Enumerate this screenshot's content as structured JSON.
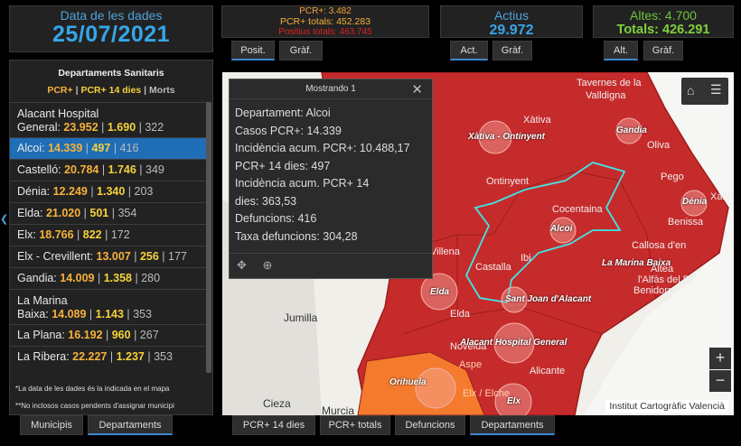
{
  "date": {
    "label": "Data de les dades",
    "value": "25/07/2021"
  },
  "pcr": {
    "pcr": "PCR+: 3.482",
    "totals": "PCR+ totals: 452.283",
    "positius": "Positius totals: 463.745"
  },
  "actius": {
    "label": "Actius",
    "value": "29.972"
  },
  "altes": {
    "label": "Altes: 4.700",
    "totals": "Totals: 426.291"
  },
  "tabs": {
    "posit": "Posit.",
    "graf1": "Gràf.",
    "act": "Act.",
    "graf2": "Gràf.",
    "alt": "Alt.",
    "graf3": "Gràf."
  },
  "list": {
    "title": "Departaments Sanitaris",
    "legend": {
      "a": "PCR+",
      "sep1": " | ",
      "b": "PCR+ 14 dies",
      "sep2": " | ",
      "c": "Morts"
    },
    "rows": [
      {
        "name": "Alacant Hospital",
        "name2": "General: ",
        "a": "23.952",
        "b": "1.690",
        "c": "322"
      },
      {
        "name": "Alcoi: ",
        "a": "14.339",
        "b": "497",
        "c": "416"
      },
      {
        "name": "Castelló: ",
        "a": "20.784",
        "b": "1.746",
        "c": "349"
      },
      {
        "name": "Dénia: ",
        "a": "12.249",
        "b": "1.340",
        "c": "203"
      },
      {
        "name": "Elda: ",
        "a": "21.020",
        "b": "501",
        "c": "354"
      },
      {
        "name": "Elx: ",
        "a": "18.766",
        "b": "822",
        "c": "172"
      },
      {
        "name": "Elx - Crevillent: ",
        "a": "13.007",
        "b": "256",
        "c": "177"
      },
      {
        "name": "Gandia: ",
        "a": "14.009",
        "b": "1.358",
        "c": "280"
      },
      {
        "name": "La Marina",
        "name2": "Baixa: ",
        "a": "14.089",
        "b": "1.143",
        "c": "353"
      },
      {
        "name": "La Plana: ",
        "a": "16.192",
        "b": "960",
        "c": "267"
      },
      {
        "name": "La Ribera: ",
        "a": "22.227",
        "b": "1.237",
        "c": "353"
      }
    ],
    "note1": "*La data de les dades és la indicada en el mapa",
    "note2": "**No inclosos casos pendents d'assignar municipi",
    "bar_sep": " | "
  },
  "popup": {
    "title": "Mostrando 1",
    "close": "✕",
    "lines": [
      "Departament: Alcoi",
      "Casos PCR+: 14.339",
      "Incidència acum. PCR+: 10.488,17",
      "PCR+ 14 dies: 497",
      "Incidència acum. PCR+ 14",
      "dies: 363,53",
      "Defuncions: 416",
      "Taxa defuncions: 304,28"
    ]
  },
  "map": {
    "credit": "Institut Cartogràfic Valencià",
    "zoom_in": "+",
    "zoom_out": "−",
    "places": {
      "tavernes": "Tavernes de la",
      "valldigna": "Valldigna",
      "xativa": "Xàtiva",
      "oliva": "Oliva",
      "pego": "Pego",
      "xabia": "Xàbia",
      "benissa": "Benissa",
      "callosa": "Callosa d'en",
      "altea": "Altea",
      "lalfas": "l'Alfàs del Pi",
      "benidorm": "Benidorm",
      "ontinyent": "Ontinyent",
      "ibi": "Ibi",
      "castalla": "Castalla",
      "cocentaina": "Cocentaina",
      "villena": "Villena",
      "elda": "Elda",
      "jumilla": "Jumilla",
      "novelda": "Novelda",
      "alacant": "Alicante",
      "aspe": "Aspe",
      "elche": "Elx / Elche",
      "cieza": "Cieza",
      "murcia": "Murcia"
    },
    "depts": {
      "xativa": "Xàtiva - Ontinyent",
      "gandia": "Gandia",
      "denia": "Dénia",
      "alcoi": "Alcoi",
      "marina": "La Marina Baixa",
      "elda": "Elda",
      "sjoan": "Sant Joan d'Alacant",
      "alacant": "Alacant Hospital General",
      "oriuela": "Orihuela",
      "elx": "Elx"
    }
  },
  "bottom_tabs": {
    "municipis": "Municipis",
    "departaments": "Departaments",
    "pcr14": "PCR+ 14 dies",
    "pcrtot": "PCR+ totals",
    "defuncions": "Defuncions",
    "departaments2": "Departaments"
  }
}
